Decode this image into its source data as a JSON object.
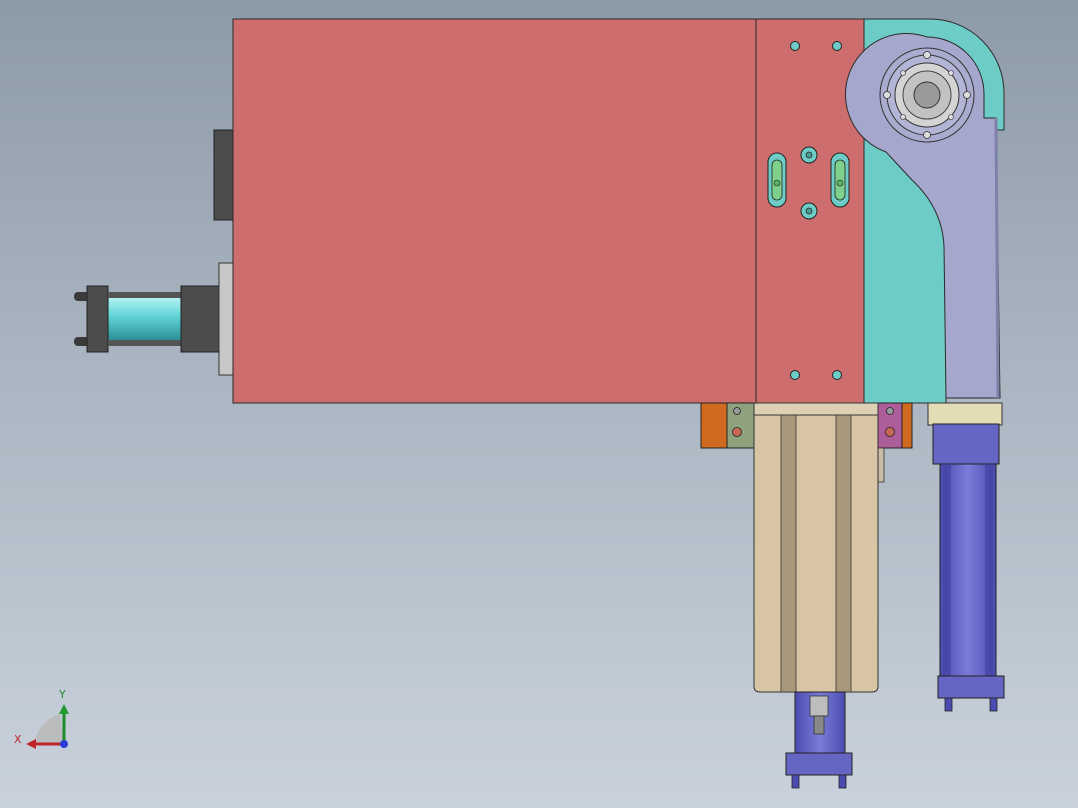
{
  "triad": {
    "y_label": "Y",
    "x_label": "X"
  },
  "colors": {
    "housing_red": "#cd6d6d",
    "teal_plate": "#6dcdc6",
    "lavender_arm": "#a5a7cd",
    "tan_slide": "#d8c5a6",
    "blue_cylinder": "#6566c4",
    "orange_block": "#d06a1f",
    "purple_block": "#ad5e9a",
    "green_slot": "#7fd08a",
    "dark_block": "#4c4c4c"
  },
  "icons": [
    "coordinate-triad-icon"
  ]
}
